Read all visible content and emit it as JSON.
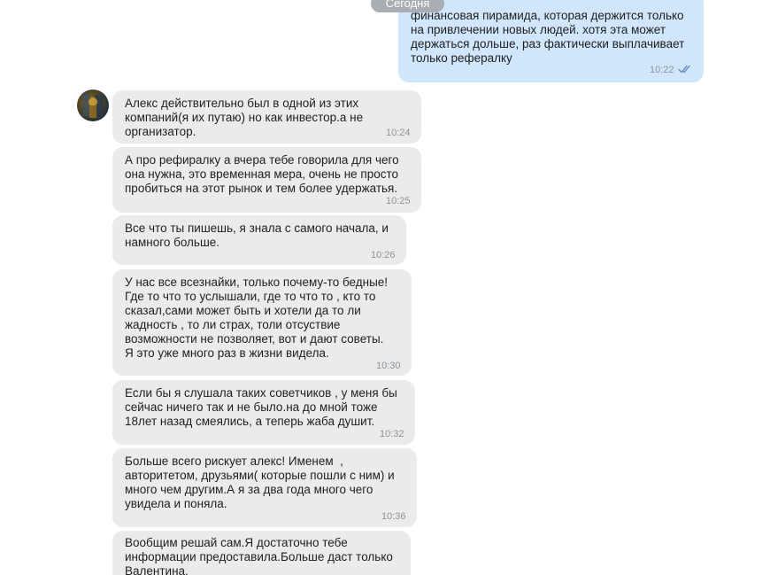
{
  "date_separator": "Сегодня",
  "outgoing": {
    "text": "финансовая пирамида, которая держится только\nна привлечении новых людей. хотя эта может\nдержаться дольше, раз фактически выплачивает\nтолько рефералку",
    "time": "10:22",
    "status_icon": "double-check-icon"
  },
  "messages": [
    {
      "text": "Алекс действительно был в одной из этих\nкомпаний(я их путаю) но как инвестор.а не\nорганизатор.",
      "time": "10:24"
    },
    {
      "text": "А про рефиралку а вчера тебе говорила для чего\nона нужна, это временная мера, очень не просто\nпробиться на этот рынок и тем более удержатья.",
      "time": "10:25"
    },
    {
      "text": "Все что ты пишешь, я знала с самого начала, и\nнамного больше.",
      "time": "10:26"
    },
    {
      "text": "У нас все всезнайки, только почему-то бедные!\nГде то что то услышали, где то что то , кто то\nсказал,сами может быть и хотели да то ли\nжадность , то ли страх, толи отсуствие\nвозможности не позволяет, вот и дают советы.\nЯ это уже много раз в жизни видела.",
      "time": "10:30"
    },
    {
      "text": "Если бы я слушала таких советчиков , у меня бы\nсейчас ничего так и не было.на до мной тоже\n18лет назад смеялись, а теперь жаба душит.",
      "time": "10:32"
    },
    {
      "text": "Больше всего рискует алекс! Именем  ,\nавторитетом, друзьями( которые пошли с ним) и\nмного чем другим.А я за два года много чего\nувидела и поняла.",
      "time": "10:36"
    },
    {
      "text": "Вообщим решай сам.Я достаточно тебе\nинформации предоставила.Больше даст только\nВалентина.",
      "time": ""
    }
  ],
  "colors": {
    "incoming_bubble": "#ebebeb",
    "outgoing_bubble": "#cfe6fb",
    "read_check": "#6e8fb8",
    "time_text": "#8d9399"
  }
}
